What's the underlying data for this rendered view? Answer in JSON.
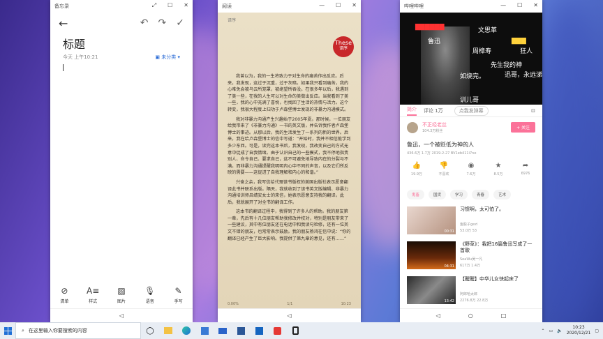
{
  "memo": {
    "window_title": "备忘录",
    "title": "标题",
    "time": "今天 上午10:21",
    "category": "未分类",
    "tools": [
      {
        "icon": "checklist-icon",
        "label": "清单"
      },
      {
        "icon": "text-style-icon",
        "label": "样式"
      },
      {
        "icon": "image-icon",
        "label": "图片"
      },
      {
        "icon": "microphone-icon",
        "label": "语音"
      },
      {
        "icon": "pen-icon",
        "label": "手写"
      }
    ]
  },
  "reader": {
    "window_title": "阅读",
    "header": "译序",
    "badge_en": "These",
    "badge_cn": "译序",
    "paragraphs": [
      "我曾以为，我的一生将致力于对生命的痛苦作出反应。后来，我发现，这过于沉重，过于灰暗。如果我只看到痛苦，我的心难免会被乌云所笼罩，被绝望所吞没。在很多年以后，我遇到了美一些，在我的人生可以对生命的美做出反应。当我看到了美一些，我的心中充满了喜悦，也找回了生活的热情与活力。这个转变，我很大程度上归功于卢森堡博士发现的非暴力沟通模式。",
      "我对非暴力沟通产生兴趣始于2005年夏。那时候，一位朋友给我带来了《非暴力沟通》一书的英文版，并告诉我作者卢森堡博士的事迹。从那以后，我的生活发生了一系列的新的世界。后来，我在给卢森堡博士的信中写道：“开始时，我并不相信能学到多少东西。可是，读完这本书后，我发现，我改变自己的方式无意中促成了自我情绪。由于认识自己的一些模式，我不停地指责别人、命令自己、要求自己，这不可避免地导致内在的分裂与不满。而非暴力沟通提醒我明明内心中不同的声音，以及它们所反映的需要——这促进了自我理解和内心的和谐。”",
      "兴奋之余，我写信给代理该书版权的美国出版社表示愿意翻译此书并联系出版。隔天，我就收到了该书英文版编辑、非暴力沟通培训师吕靖安女士的来信，她表示愿意支持我的翻译，此后，我就展开了对全书的翻译工作。",
      "这本书的翻译过程中，我得到了许多人的帮助。我的朋友第一章，先后有十几位朋友帮助我修改并校对，特别是朋友带来了一些建议，其中有位朋友还在电话中和我读句检修，还有一位英文不错的朋友，也常常表示鼓励。我的朋友杨鸿在信中说：“你的翻译已经产生了巨大影响。我提供了第九章的意见，还有……”"
    ],
    "progress": "0.00%",
    "page_label": "1/1",
    "time": "10:23"
  },
  "video": {
    "window_title": "哔哩哔哩",
    "danmaku": [
      {
        "text": "文思革",
        "class": "dan-white"
      },
      {
        "text": "鲁迅",
        "class": "dan-white"
      },
      {
        "text": "周樟寿",
        "class": "dan-white"
      },
      {
        "text": "狂人",
        "class": "dan-white"
      },
      {
        "text": "先生我的神",
        "class": "dan-white"
      },
      {
        "text": "迅哥，永远涕",
        "class": "dan-white"
      },
      {
        "text": "如烧完。",
        "class": "dan-white"
      },
      {
        "text": "训儿哥",
        "class": "dan-white"
      }
    ],
    "tabs": [
      "简介",
      "评论 1万"
    ],
    "danmaku_input": "点我发弹幕",
    "uploader": "不正经老丝",
    "fans": "104.3万粉丝",
    "follow": "+ 关注",
    "title": "鲁迅，一个被贬低为神的人",
    "stats": "436.6万  1.7万  2019-2-27  BV1eb411i7ne",
    "actions": [
      {
        "icon": "thumb-up-icon",
        "label": "19.9万"
      },
      {
        "icon": "thumb-down-icon",
        "label": "不喜欢"
      },
      {
        "icon": "coin-icon",
        "label": "7.6万"
      },
      {
        "icon": "star-icon",
        "label": "8.5万"
      },
      {
        "icon": "share-icon",
        "label": "6976"
      }
    ],
    "tags": [
      "鬼畜",
      "国货",
      "学习",
      "青春",
      "艺术"
    ],
    "recs": [
      {
        "title": "习惯啊，太可怕了。",
        "author": "鱼股子gezi",
        "stats": "53.0万  53",
        "dur": "00:31"
      },
      {
        "title": "《野草》：我把16篇鲁迅写成了一首歌",
        "author": "SeaWu吴一凡",
        "stats": "617万  1.4万",
        "dur": "04:31"
      },
      {
        "title": "【醒醒】中华儿女快起床了",
        "author": "阿郎哈太郎",
        "stats": "2276.8万  22.8万",
        "dur": "13:42"
      }
    ]
  },
  "taskbar": {
    "search_placeholder": "在这里输入你要搜索的内容",
    "time": "10:23",
    "date": "2020/12/21"
  }
}
